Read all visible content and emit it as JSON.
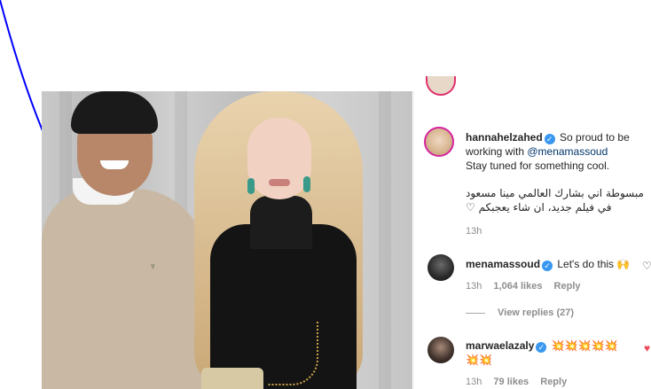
{
  "post": {
    "caption": {
      "username": "hannahelzahed",
      "verified_glyph": "✓",
      "text_before_mention": "So proud to be working with ",
      "mention": "@menamassoud",
      "text_line2": "Stay tuned for something cool.",
      "arabic_line1": "مبسوطة اني بشارك العالمي مينا مسعود",
      "arabic_line2": "في فيلم جديد، ان شاء يعجبكم ♡",
      "time": "13h"
    },
    "comments": [
      {
        "username": "menamassoud",
        "verified_glyph": "✓",
        "text": "Let's do this 🙌",
        "time": "13h",
        "likes": "1,064 likes",
        "reply_label": "Reply",
        "view_replies": "View replies (27)"
      },
      {
        "username": "marwaelazaly",
        "verified_glyph": "✓",
        "text": "💥💥💥💥💥💥💥",
        "time": "13h",
        "likes": "79 likes",
        "reply_label": "Reply"
      }
    ]
  },
  "colors": {
    "accent_blue": "#3897f0",
    "mention": "#00376b",
    "muted": "#8e8e8e",
    "annotation_line": "#0000ff",
    "heart_red": "#ed4956"
  },
  "icons": [
    "verified-badge-icon",
    "heart-icon",
    "heart-filled-icon"
  ]
}
